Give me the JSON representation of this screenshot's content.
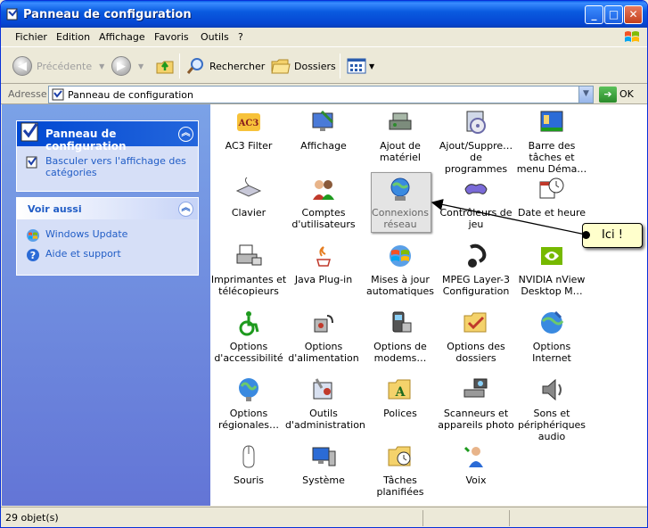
{
  "window": {
    "title": "Panneau de configuration",
    "buttons": {
      "minimize": "_",
      "maximize": "□",
      "close": "✕"
    }
  },
  "menu": [
    "Fichier",
    "Edition",
    "Affichage",
    "Favoris",
    "Outils",
    "?"
  ],
  "toolbar": {
    "back_label": "Précédente",
    "search_label": "Rechercher",
    "folders_label": "Dossiers"
  },
  "address": {
    "label": "Adresse",
    "value": "Panneau de configuration",
    "go_label": "OK"
  },
  "leftpane": {
    "panel1": {
      "title": "Panneau de configuration",
      "link": "Basculer vers l'affichage des catégories"
    },
    "panel2": {
      "title": "Voir aussi",
      "links": [
        "Windows Update",
        "Aide et support"
      ]
    }
  },
  "items": [
    {
      "label": "AC3 Filter",
      "icon": "ac3-filter-icon"
    },
    {
      "label": "Affichage",
      "icon": "display-icon"
    },
    {
      "label": "Ajout de matériel",
      "icon": "add-hardware-icon"
    },
    {
      "label": "Ajout/Suppre… de programmes",
      "icon": "add-remove-programs-icon"
    },
    {
      "label": "Barre des tâches et menu Déma…",
      "icon": "taskbar-icon"
    },
    {
      "label": "Clavier",
      "icon": "keyboard-icon"
    },
    {
      "label": "Comptes d'utilisateurs",
      "icon": "user-accounts-icon"
    },
    {
      "label": "Connexions réseau",
      "icon": "network-connections-icon"
    },
    {
      "label": "Contrôleurs de jeu",
      "icon": "game-controllers-icon"
    },
    {
      "label": "Date et heure",
      "icon": "date-time-icon"
    },
    {
      "label": "Imprimantes et télécopieurs",
      "icon": "printers-icon"
    },
    {
      "label": "Java Plug-in",
      "icon": "java-icon"
    },
    {
      "label": "Mises à jour automatiques",
      "icon": "automatic-updates-icon"
    },
    {
      "label": "MPEG Layer-3 Configuration",
      "icon": "mpeg-icon"
    },
    {
      "label": "NVIDIA nView Desktop M…",
      "icon": "nvidia-icon"
    },
    {
      "label": "Options d'accessibilité",
      "icon": "accessibility-icon"
    },
    {
      "label": "Options d'alimentation",
      "icon": "power-icon"
    },
    {
      "label": "Options de modems…",
      "icon": "modem-icon"
    },
    {
      "label": "Options des dossiers",
      "icon": "folder-options-icon"
    },
    {
      "label": "Options Internet",
      "icon": "internet-options-icon"
    },
    {
      "label": "Options régionales…",
      "icon": "regional-options-icon"
    },
    {
      "label": "Outils d'administration",
      "icon": "admin-tools-icon"
    },
    {
      "label": "Polices",
      "icon": "fonts-icon"
    },
    {
      "label": "Scanneurs et appareils photo",
      "icon": "scanner-icon"
    },
    {
      "label": "Sons et périphériques audio",
      "icon": "sound-icon"
    },
    {
      "label": "Souris",
      "icon": "mouse-icon"
    },
    {
      "label": "Système",
      "icon": "system-icon"
    },
    {
      "label": "Tâches planifiées",
      "icon": "scheduled-tasks-icon"
    },
    {
      "label": "Voix",
      "icon": "speech-icon"
    }
  ],
  "callout": "Ici !",
  "status": "29 objet(s)"
}
